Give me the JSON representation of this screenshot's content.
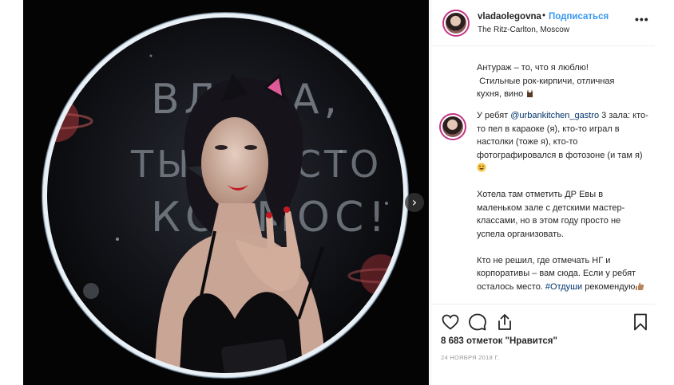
{
  "post": {
    "photo": {
      "wall_text": [
        "ВЛАДА,",
        "ТЫ ПРОСТО",
        "КОСМОС!"
      ],
      "next_button_glyph": "›"
    },
    "header": {
      "username": "vladaolegovna",
      "separator": "•",
      "follow_label": "Подписаться",
      "location": "The Ritz-Carlton, Moscow",
      "more_glyph": "•••"
    },
    "caption": {
      "line1": "Антураж – то, что я люблю!",
      "line2": "Стильные рок-кирпичи, отличная кухня, вино"
    },
    "comment": {
      "p1_prefix": "У ребят ",
      "p1_mention": "@urbankitchen_gastro",
      "p1_rest": " 3 зала: кто-то пел в караоке (я), кто-то играл в настолки (тоже я), кто-то фотографировался в фотозоне (и там я)",
      "p2": "Хотела там отметить ДР Евы в маленьком зале с детскими мастер-классами, но в этом году просто не успела организовать.",
      "p3_prefix": "Кто не решил, где отмечать НГ и корпоративы – вам сюда. Если у ребят осталось место. ",
      "p3_hashtag": "#Отдуши",
      "p3_rest": " рекомендую"
    },
    "likes": "8 683 отметок \"Нравится\"",
    "date": "24 НОЯБРЯ 2018 Г."
  },
  "colors": {
    "accent_blue": "#3897f0",
    "link": "#003569",
    "text": "#262626",
    "muted": "#999999",
    "divider": "#efefef"
  },
  "icons": [
    "heart-icon",
    "comment-icon",
    "share-icon",
    "bookmark-icon",
    "more-icon",
    "chevron-right-icon"
  ]
}
